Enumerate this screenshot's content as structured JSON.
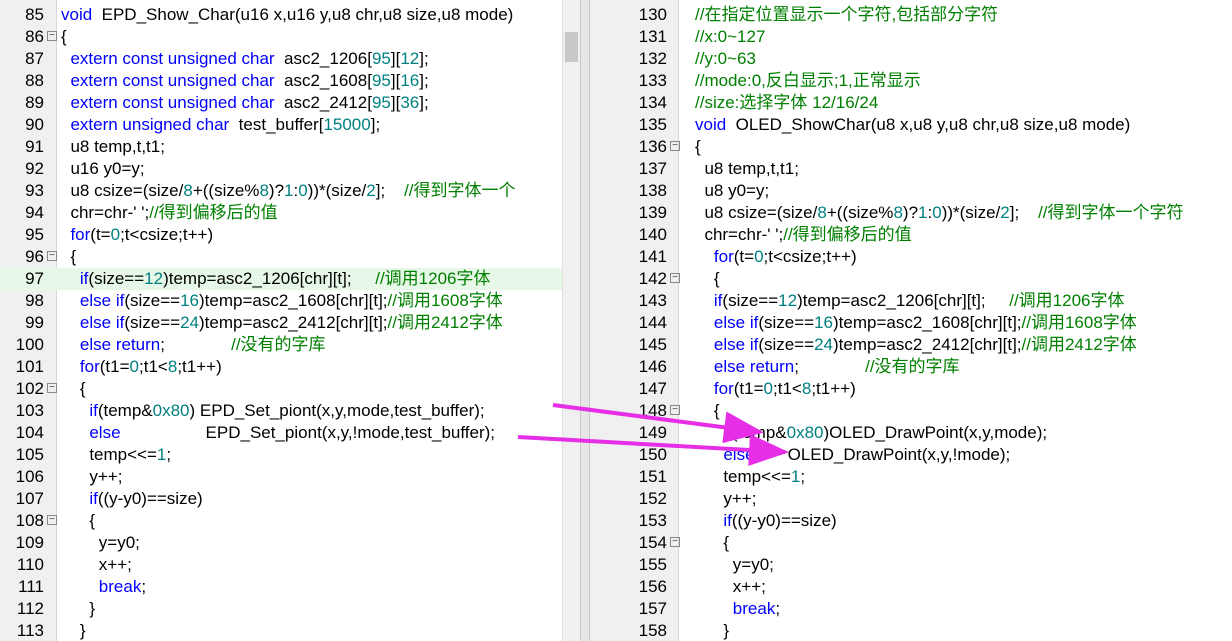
{
  "left": {
    "lines": [
      {
        "n": "85",
        "fold": false,
        "hl": false,
        "segs": [
          [
            "kw",
            "void"
          ],
          [
            "",
            "  EPD_Show_Char(u16 x,u16 y,u8 chr,u8 size,u8 mode)"
          ]
        ]
      },
      {
        "n": "86",
        "fold": true,
        "hl": false,
        "segs": [
          [
            "",
            "{"
          ]
        ]
      },
      {
        "n": "87",
        "fold": false,
        "hl": false,
        "segs": [
          [
            "",
            "  "
          ],
          [
            "kw",
            "extern const unsigned char"
          ],
          [
            "",
            "  asc2_1206["
          ],
          [
            "num",
            "95"
          ],
          [
            "",
            "]["
          ],
          [
            "num",
            "12"
          ],
          [
            "",
            "];"
          ]
        ]
      },
      {
        "n": "88",
        "fold": false,
        "hl": false,
        "segs": [
          [
            "",
            "  "
          ],
          [
            "kw",
            "extern const unsigned char"
          ],
          [
            "",
            "  asc2_1608["
          ],
          [
            "num",
            "95"
          ],
          [
            "",
            "]["
          ],
          [
            "num",
            "16"
          ],
          [
            "",
            "];"
          ]
        ]
      },
      {
        "n": "89",
        "fold": false,
        "hl": false,
        "segs": [
          [
            "",
            "  "
          ],
          [
            "kw",
            "extern const unsigned char"
          ],
          [
            "",
            "  asc2_2412["
          ],
          [
            "num",
            "95"
          ],
          [
            "",
            "]["
          ],
          [
            "num",
            "36"
          ],
          [
            "",
            "];"
          ]
        ]
      },
      {
        "n": "90",
        "fold": false,
        "hl": false,
        "segs": [
          [
            "",
            "  "
          ],
          [
            "kw",
            "extern unsigned char"
          ],
          [
            "",
            "  test_buffer["
          ],
          [
            "num",
            "15000"
          ],
          [
            "",
            "];"
          ]
        ]
      },
      {
        "n": "91",
        "fold": false,
        "hl": false,
        "segs": [
          [
            "",
            "  u8 temp,t,t1;"
          ]
        ]
      },
      {
        "n": "92",
        "fold": false,
        "hl": false,
        "segs": [
          [
            "",
            "  u16 y0=y;"
          ]
        ]
      },
      {
        "n": "93",
        "fold": false,
        "hl": false,
        "segs": [
          [
            "",
            "  u8 csize=(size/"
          ],
          [
            "num",
            "8"
          ],
          [
            "",
            "+((size%"
          ],
          [
            "num",
            "8"
          ],
          [
            "",
            ")?"
          ],
          [
            "num",
            "1"
          ],
          [
            "",
            ":"
          ],
          [
            "num",
            "0"
          ],
          [
            "",
            "))*(size/"
          ],
          [
            "num",
            "2"
          ],
          [
            "",
            "];    "
          ],
          [
            "cm",
            "//得到字体一个"
          ]
        ]
      },
      {
        "n": "94",
        "fold": false,
        "hl": false,
        "segs": [
          [
            "",
            "  chr=chr-' ';"
          ],
          [
            "cm",
            "//得到偏移后的值"
          ]
        ]
      },
      {
        "n": "95",
        "fold": false,
        "hl": false,
        "segs": [
          [
            "",
            "  "
          ],
          [
            "kw",
            "for"
          ],
          [
            "",
            "(t="
          ],
          [
            "num",
            "0"
          ],
          [
            "",
            ";t<csize;t++)"
          ]
        ]
      },
      {
        "n": "96",
        "fold": true,
        "hl": false,
        "segs": [
          [
            "",
            "  {"
          ]
        ]
      },
      {
        "n": "97",
        "fold": false,
        "hl": true,
        "segs": [
          [
            "",
            "    "
          ],
          [
            "kw",
            "if"
          ],
          [
            "",
            "(size=="
          ],
          [
            "num",
            "12"
          ],
          [
            "",
            ")temp=asc2_1206[chr][t];     "
          ],
          [
            "cm",
            "//调用1206字体"
          ]
        ]
      },
      {
        "n": "98",
        "fold": false,
        "hl": false,
        "segs": [
          [
            "",
            "    "
          ],
          [
            "kw",
            "else if"
          ],
          [
            "",
            "(size=="
          ],
          [
            "num",
            "16"
          ],
          [
            "",
            ")temp=asc2_1608[chr][t];"
          ],
          [
            "cm",
            "//调用1608字体"
          ]
        ]
      },
      {
        "n": "99",
        "fold": false,
        "hl": false,
        "segs": [
          [
            "",
            "    "
          ],
          [
            "kw",
            "else if"
          ],
          [
            "",
            "(size=="
          ],
          [
            "num",
            "24"
          ],
          [
            "",
            ")temp=asc2_2412[chr][t];"
          ],
          [
            "cm",
            "//调用2412字体"
          ]
        ]
      },
      {
        "n": "100",
        "fold": false,
        "hl": false,
        "segs": [
          [
            "",
            "    "
          ],
          [
            "kw",
            "else return"
          ],
          [
            "",
            ";              "
          ],
          [
            "cm",
            "//没有的字库"
          ]
        ]
      },
      {
        "n": "101",
        "fold": false,
        "hl": false,
        "segs": [
          [
            "",
            "    "
          ],
          [
            "kw",
            "for"
          ],
          [
            "",
            "(t1="
          ],
          [
            "num",
            "0"
          ],
          [
            "",
            ";t1<"
          ],
          [
            "num",
            "8"
          ],
          [
            "",
            ";t1++)"
          ]
        ]
      },
      {
        "n": "102",
        "fold": true,
        "hl": false,
        "segs": [
          [
            "",
            "    {"
          ]
        ]
      },
      {
        "n": "103",
        "fold": false,
        "hl": false,
        "segs": [
          [
            "",
            "      "
          ],
          [
            "kw",
            "if"
          ],
          [
            "",
            "(temp&"
          ],
          [
            "num",
            "0x80"
          ],
          [
            "",
            ") EPD_Set_piont(x,y,mode,test_buffer);"
          ]
        ]
      },
      {
        "n": "104",
        "fold": false,
        "hl": false,
        "segs": [
          [
            "",
            "      "
          ],
          [
            "kw",
            "else"
          ],
          [
            "",
            "                  EPD_Set_piont(x,y,!mode,test_buffer);"
          ]
        ]
      },
      {
        "n": "105",
        "fold": false,
        "hl": false,
        "segs": [
          [
            "",
            "      temp<<="
          ],
          [
            "num",
            "1"
          ],
          [
            "",
            ";"
          ]
        ]
      },
      {
        "n": "106",
        "fold": false,
        "hl": false,
        "segs": [
          [
            "",
            "      y++;"
          ]
        ]
      },
      {
        "n": "107",
        "fold": false,
        "hl": false,
        "segs": [
          [
            "",
            "      "
          ],
          [
            "kw",
            "if"
          ],
          [
            "",
            "((y-y0)==size)"
          ]
        ]
      },
      {
        "n": "108",
        "fold": true,
        "hl": false,
        "segs": [
          [
            "",
            "      {"
          ]
        ]
      },
      {
        "n": "109",
        "fold": false,
        "hl": false,
        "segs": [
          [
            "",
            "        y=y0;"
          ]
        ]
      },
      {
        "n": "110",
        "fold": false,
        "hl": false,
        "segs": [
          [
            "",
            "        x++;"
          ]
        ]
      },
      {
        "n": "111",
        "fold": false,
        "hl": false,
        "segs": [
          [
            "",
            "        "
          ],
          [
            "kw",
            "break"
          ],
          [
            "",
            ";"
          ]
        ]
      },
      {
        "n": "112",
        "fold": false,
        "hl": false,
        "segs": [
          [
            "",
            "      }"
          ]
        ]
      },
      {
        "n": "113",
        "fold": false,
        "hl": false,
        "segs": [
          [
            "",
            "    }"
          ]
        ]
      }
    ]
  },
  "right": {
    "lines": [
      {
        "n": "130",
        "fold": false,
        "hl": false,
        "segs": [
          [
            "cm",
            "//在指定位置显示一个字符,包括部分字符"
          ]
        ]
      },
      {
        "n": "131",
        "fold": false,
        "hl": false,
        "segs": [
          [
            "cm",
            "//x:0~127"
          ]
        ]
      },
      {
        "n": "132",
        "fold": false,
        "hl": false,
        "segs": [
          [
            "cm",
            "//y:0~63"
          ]
        ]
      },
      {
        "n": "133",
        "fold": false,
        "hl": false,
        "segs": [
          [
            "cm",
            "//mode:0,反白显示;1,正常显示"
          ]
        ]
      },
      {
        "n": "134",
        "fold": false,
        "hl": false,
        "segs": [
          [
            "cm",
            "//size:选择字体 12/16/24"
          ]
        ]
      },
      {
        "n": "135",
        "fold": false,
        "hl": false,
        "segs": [
          [
            "kw",
            "void"
          ],
          [
            "",
            "  OLED_ShowChar(u8 x,u8 y,u8 chr,u8 size,u8 mode)"
          ]
        ]
      },
      {
        "n": "136",
        "fold": true,
        "hl": false,
        "segs": [
          [
            "",
            "{"
          ]
        ]
      },
      {
        "n": "137",
        "fold": false,
        "hl": false,
        "segs": [
          [
            "",
            "  u8 temp,t,t1;"
          ]
        ]
      },
      {
        "n": "138",
        "fold": false,
        "hl": false,
        "segs": [
          [
            "",
            "  u8 y0=y;"
          ]
        ]
      },
      {
        "n": "139",
        "fold": false,
        "hl": false,
        "segs": [
          [
            "",
            "  u8 csize=(size/"
          ],
          [
            "num",
            "8"
          ],
          [
            "",
            "+((size%"
          ],
          [
            "num",
            "8"
          ],
          [
            "",
            ")?"
          ],
          [
            "num",
            "1"
          ],
          [
            "",
            ":"
          ],
          [
            "num",
            "0"
          ],
          [
            "",
            "))*(size/"
          ],
          [
            "num",
            "2"
          ],
          [
            "",
            "];    "
          ],
          [
            "cm",
            "//得到字体一个字符"
          ]
        ]
      },
      {
        "n": "140",
        "fold": false,
        "hl": false,
        "segs": [
          [
            "",
            "  chr=chr-' ';"
          ],
          [
            "cm",
            "//得到偏移后的值"
          ]
        ]
      },
      {
        "n": "141",
        "fold": false,
        "hl": false,
        "segs": [
          [
            "",
            "    "
          ],
          [
            "kw",
            "for"
          ],
          [
            "",
            "(t="
          ],
          [
            "num",
            "0"
          ],
          [
            "",
            ";t<csize;t++)"
          ]
        ]
      },
      {
        "n": "142",
        "fold": true,
        "hl": false,
        "segs": [
          [
            "",
            "    {"
          ]
        ]
      },
      {
        "n": "143",
        "fold": false,
        "hl": false,
        "segs": [
          [
            "",
            "    "
          ],
          [
            "kw",
            "if"
          ],
          [
            "",
            "(size=="
          ],
          [
            "num",
            "12"
          ],
          [
            "",
            ")temp=asc2_1206[chr][t];     "
          ],
          [
            "cm",
            "//调用1206字体"
          ]
        ]
      },
      {
        "n": "144",
        "fold": false,
        "hl": false,
        "segs": [
          [
            "",
            "    "
          ],
          [
            "kw",
            "else if"
          ],
          [
            "",
            "(size=="
          ],
          [
            "num",
            "16"
          ],
          [
            "",
            ")temp=asc2_1608[chr][t];"
          ],
          [
            "cm",
            "//调用1608字体"
          ]
        ]
      },
      {
        "n": "145",
        "fold": false,
        "hl": false,
        "segs": [
          [
            "",
            "    "
          ],
          [
            "kw",
            "else if"
          ],
          [
            "",
            "(size=="
          ],
          [
            "num",
            "24"
          ],
          [
            "",
            ")temp=asc2_2412[chr][t];"
          ],
          [
            "cm",
            "//调用2412字体"
          ]
        ]
      },
      {
        "n": "146",
        "fold": false,
        "hl": false,
        "segs": [
          [
            "",
            "    "
          ],
          [
            "kw",
            "else return"
          ],
          [
            "",
            ";              "
          ],
          [
            "cm",
            "//没有的字库"
          ]
        ]
      },
      {
        "n": "147",
        "fold": false,
        "hl": false,
        "segs": [
          [
            "",
            "    "
          ],
          [
            "kw",
            "for"
          ],
          [
            "",
            "(t1="
          ],
          [
            "num",
            "0"
          ],
          [
            "",
            ";t1<"
          ],
          [
            "num",
            "8"
          ],
          [
            "",
            ";t1++)"
          ]
        ]
      },
      {
        "n": "148",
        "fold": true,
        "hl": false,
        "segs": [
          [
            "",
            "    {"
          ]
        ]
      },
      {
        "n": "149",
        "fold": false,
        "hl": false,
        "segs": [
          [
            "",
            "      "
          ],
          [
            "kw",
            "if"
          ],
          [
            "",
            "(temp&"
          ],
          [
            "num",
            "0x80"
          ],
          [
            "",
            ")OLED_DrawPoint(x,y,mode);"
          ]
        ]
      },
      {
        "n": "150",
        "fold": false,
        "hl": false,
        "segs": [
          [
            "",
            "      "
          ],
          [
            "kw",
            "else"
          ],
          [
            "",
            "       OLED_DrawPoint(x,y,!mode);"
          ]
        ]
      },
      {
        "n": "151",
        "fold": false,
        "hl": false,
        "segs": [
          [
            "",
            "      temp<<="
          ],
          [
            "num",
            "1"
          ],
          [
            "",
            ";"
          ]
        ]
      },
      {
        "n": "152",
        "fold": false,
        "hl": false,
        "segs": [
          [
            "",
            "      y++;"
          ]
        ]
      },
      {
        "n": "153",
        "fold": false,
        "hl": false,
        "segs": [
          [
            "",
            "      "
          ],
          [
            "kw",
            "if"
          ],
          [
            "",
            "((y-y0)==size)"
          ]
        ]
      },
      {
        "n": "154",
        "fold": true,
        "hl": false,
        "segs": [
          [
            "",
            "      {"
          ]
        ]
      },
      {
        "n": "155",
        "fold": false,
        "hl": false,
        "segs": [
          [
            "",
            "        y=y0;"
          ]
        ]
      },
      {
        "n": "156",
        "fold": false,
        "hl": false,
        "segs": [
          [
            "",
            "        x++;"
          ]
        ]
      },
      {
        "n": "157",
        "fold": false,
        "hl": false,
        "segs": [
          [
            "",
            "        "
          ],
          [
            "kw",
            "break"
          ],
          [
            "",
            ";"
          ]
        ]
      },
      {
        "n": "158",
        "fold": false,
        "hl": false,
        "segs": [
          [
            "",
            "      }"
          ]
        ]
      }
    ]
  },
  "colors": {
    "keyword": "#0000ff",
    "number": "#008080",
    "comment": "#008000",
    "highlight": "#e8f8e8",
    "arrow": "#e62ee6"
  },
  "icons": {
    "fold_marker": "minus-square-icon"
  }
}
